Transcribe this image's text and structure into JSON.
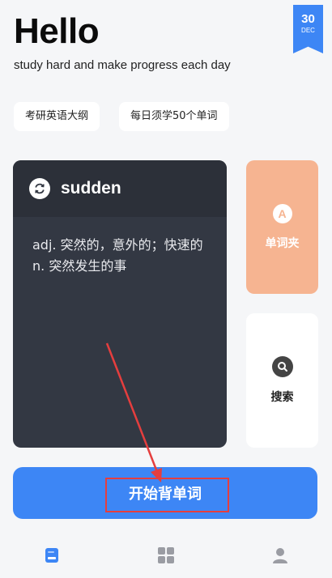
{
  "header": {
    "greeting": "Hello",
    "subtitle": "study hard and make progress each day"
  },
  "date_badge": {
    "day": "30",
    "month": "DEC",
    "color": "#3d86f5"
  },
  "tags": [
    "考研英语大纲",
    "每日须学50个单词"
  ],
  "word_card": {
    "word": "sudden",
    "meanings": [
      "adj. 突然的，意外的；快速的",
      "n. 突然发生的事"
    ],
    "icon": "refresh-icon"
  },
  "side_buttons": {
    "wordbook": {
      "label": "单词夹",
      "icon_letter": "A",
      "color": "#f6b491"
    },
    "search": {
      "label": "搜索",
      "icon": "search-icon"
    }
  },
  "start_button": {
    "label": "开始背单词",
    "color": "#3d86f5"
  },
  "tabbar": {
    "tabs": [
      {
        "icon": "book-icon",
        "active": true
      },
      {
        "icon": "grid-icon",
        "active": false
      },
      {
        "icon": "user-icon",
        "active": false
      }
    ]
  },
  "annotation": {
    "color": "#e53e3e"
  }
}
